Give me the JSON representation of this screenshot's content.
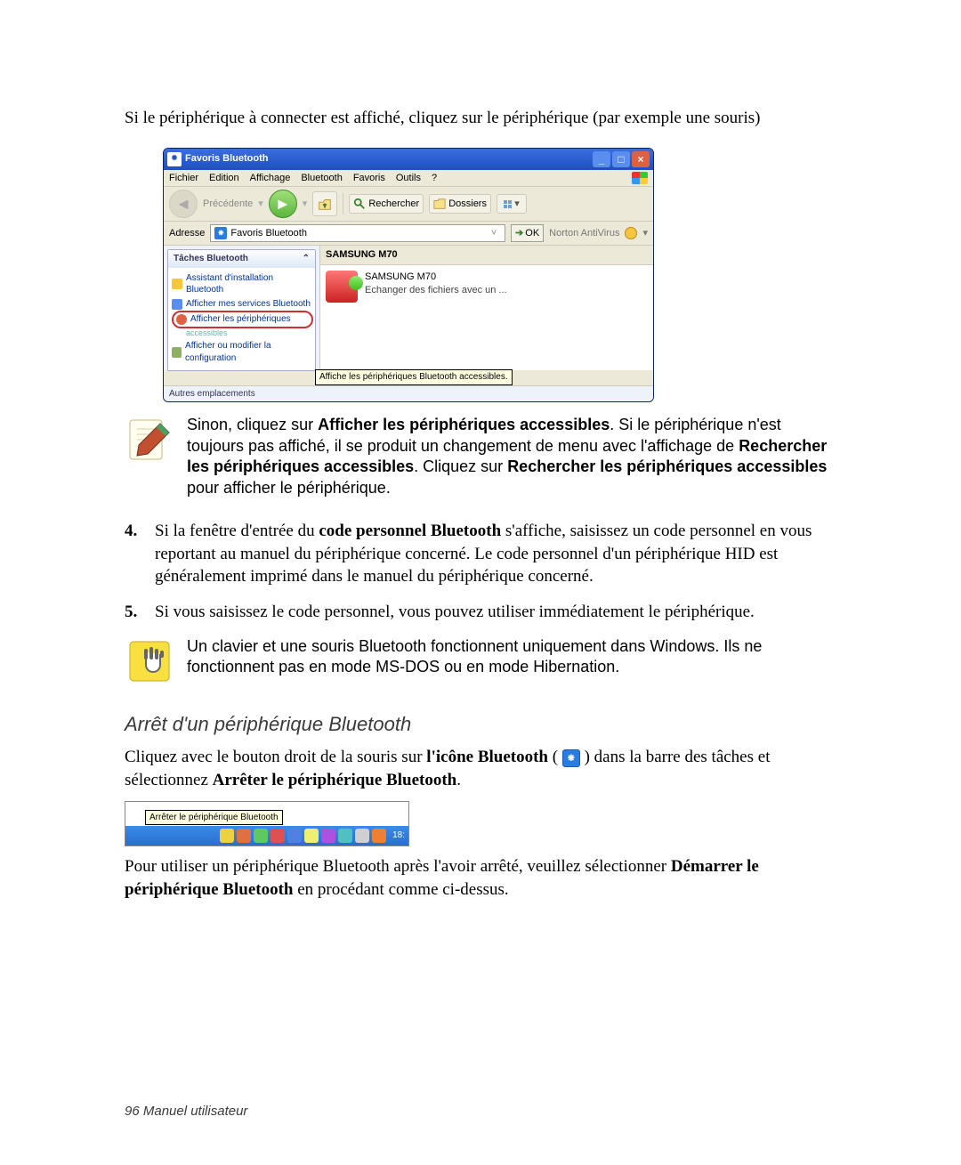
{
  "intro_text": "Si le périphérique à connecter est affiché, cliquez sur le périphérique (par exemple une souris)",
  "xp": {
    "title": "Favoris Bluetooth",
    "menus": [
      "Fichier",
      "Edition",
      "Affichage",
      "Bluetooth",
      "Favoris",
      "Outils",
      "?"
    ],
    "back_label": "Précédente",
    "search_label": "Rechercher",
    "folders_label": "Dossiers",
    "address_label": "Adresse",
    "address_value": "Favoris Bluetooth",
    "ok_label": "OK",
    "norton_label": "Norton AntiVirus",
    "task_header": "Tâches Bluetooth",
    "task_items": [
      "Assistant d'installation Bluetooth",
      "Afficher mes services Bluetooth",
      "Afficher les périphériques",
      "accessibles",
      "Afficher ou modifier la configuration"
    ],
    "tooltip": "Affiche les périphériques Bluetooth accessibles.",
    "column_header": "SAMSUNG M70",
    "item_title": "SAMSUNG M70",
    "item_sub": "Echanger des fichiers avec un ...",
    "footer_text": "Autres emplacements"
  },
  "note1": {
    "pre": "Sinon, cliquez sur ",
    "b1": "Afficher les périphériques accessibles",
    "mid1": ". Si le périphérique n'est toujours pas affiché, il se produit un changement de menu avec l'affichage de ",
    "b2": "Rechercher les périphériques accessibles",
    "mid2": ". Cliquez sur ",
    "b3": "Rechercher les périphériques accessibles",
    "post": " pour afficher le périphérique."
  },
  "steps": {
    "s4_num": "4.",
    "s4a": "Si la fenêtre d'entrée du ",
    "s4b": "code personnel Bluetooth",
    "s4c": " s'affiche, saisissez un code personnel en vous reportant au manuel du périphérique concerné. Le code personnel d'un périphérique HID est généralement imprimé dans le manuel du périphérique concerné.",
    "s5_num": "5.",
    "s5": "Si vous saisissez le code personnel, vous pouvez utiliser immédiatement le périphérique."
  },
  "note2": "Un clavier et une souris Bluetooth fonctionnent uniquement dans Windows. Ils ne fonctionnent pas en mode MS-DOS ou en mode Hibernation.",
  "section_heading": "Arrêt d'un périphérique Bluetooth",
  "stop1a": "Cliquez avec le bouton droit de la souris sur ",
  "stop1b": "l'icône Bluetooth",
  "stop1c": " ( ",
  "stop1d": " ) dans la barre des tâches et sélectionnez ",
  "stop1e": "Arrêter le  périphérique Bluetooth",
  "stop1f": ".",
  "taskbar_tooltip": "Arrêter le périphérique Bluetooth",
  "taskbar_time": "18:",
  "stop2a": "Pour utiliser un périphérique Bluetooth après l'avoir arrêté, veuillez sélectionner ",
  "stop2b": "Démarrer le périphérique Bluetooth",
  "stop2c": " en procédant comme ci-dessus.",
  "footer": "96  Manuel utilisateur"
}
